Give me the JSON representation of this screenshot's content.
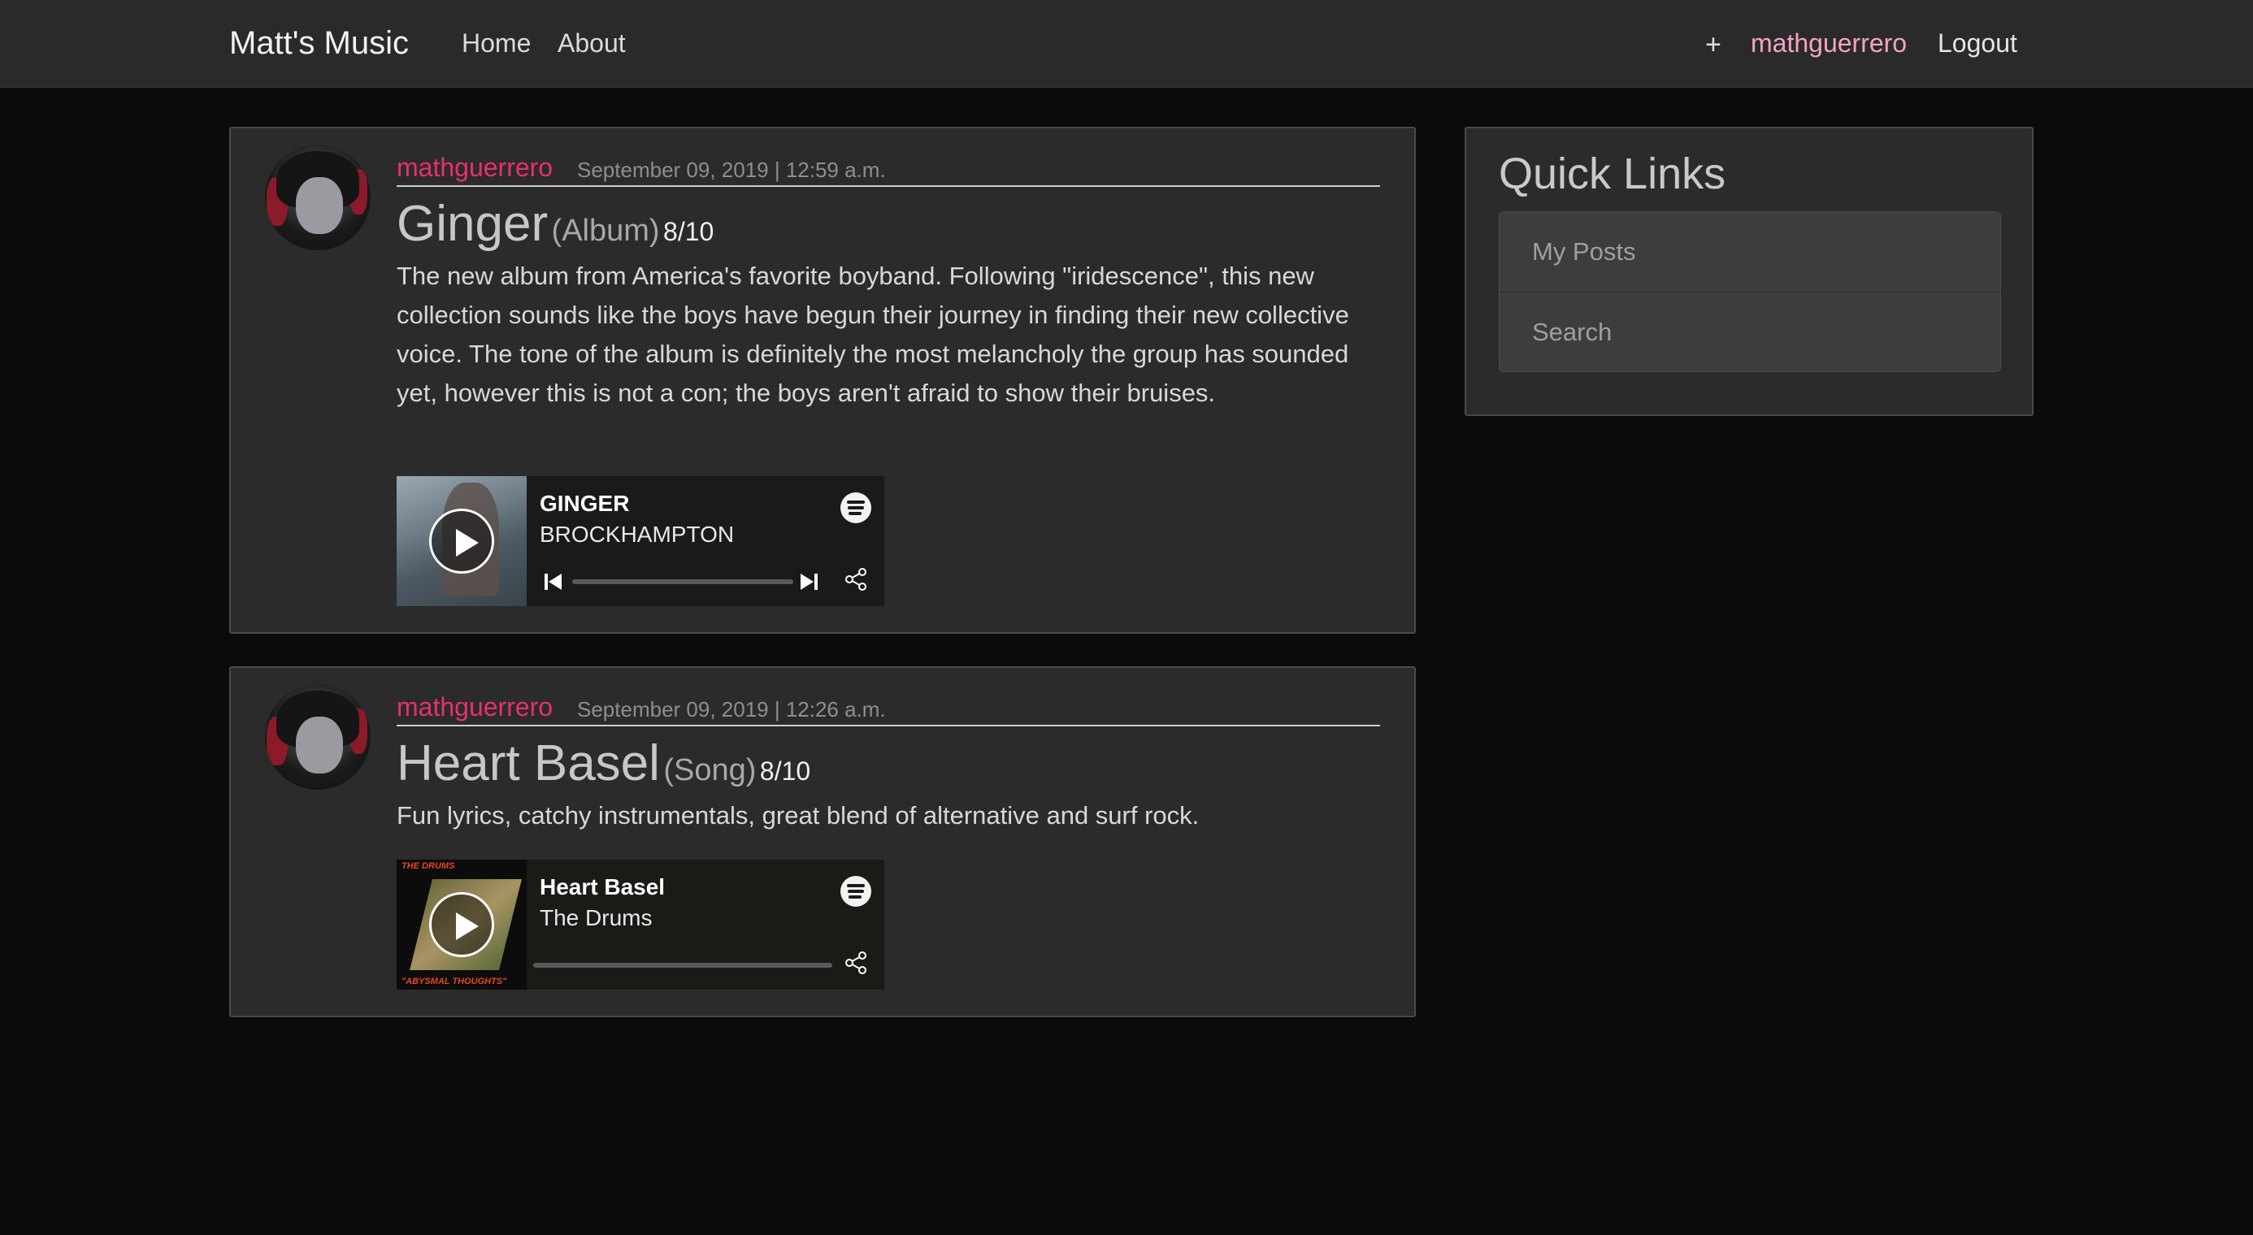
{
  "nav": {
    "brand": "Matt's Music",
    "links": [
      "Home",
      "About"
    ],
    "plus": "+",
    "username": "mathguerrero",
    "logout": "Logout"
  },
  "posts": [
    {
      "author": "mathguerrero",
      "date": "September 09, 2019 | 12:59 a.m.",
      "title": "Ginger",
      "kind": "(Album)",
      "rating": "8/10",
      "body": "The new album from America's favorite boyband. Following \"iridescence\", this new collection sounds like the boys have begun their journey in finding their new collective voice. The tone of the album is definitely the most melancholy the group has sounded yet, however this is not a con; the boys aren't afraid to show their bruises.",
      "player": {
        "track": "GINGER",
        "artist": "BROCKHAMPTON"
      }
    },
    {
      "author": "mathguerrero",
      "date": "September 09, 2019 | 12:26 a.m.",
      "title": "Heart Basel",
      "kind": "(Song)",
      "rating": "8/10",
      "body": "Fun lyrics, catchy instrumentals, great blend of alternative and surf rock.",
      "player": {
        "track": "Heart Basel",
        "artist": "The Drums",
        "cover_top": "THE DRUMS",
        "cover_bottom": "\"ABYSMAL THOUGHTS\""
      }
    }
  ],
  "quick_links": {
    "title": "Quick Links",
    "items": [
      "My Posts",
      "Search"
    ]
  },
  "colors": {
    "accent_pink": "#e6306f",
    "nav_user_pink": "#f3a3c3",
    "background": "#0b0b0b",
    "card": "#2b2b2c"
  },
  "icons": [
    "spotify-icon",
    "play-icon",
    "skip-back-icon",
    "skip-forward-icon",
    "share-icon"
  ]
}
